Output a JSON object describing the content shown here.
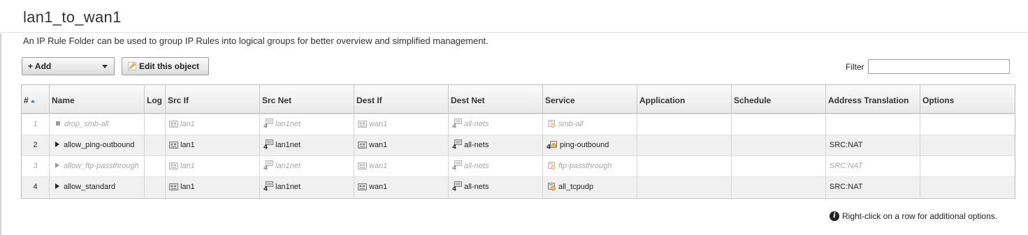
{
  "page": {
    "title": "lan1_to_wan1",
    "description": "An IP Rule Folder can be used to group IP Rules into logical groups for better overview and simplified management."
  },
  "toolbar": {
    "add_label": "+ Add",
    "edit_label": "Edit this object",
    "filter_label": "Filter",
    "filter_value": ""
  },
  "table": {
    "columns": [
      "#",
      "Name",
      "Log",
      "Src If",
      "Src Net",
      "Dest If",
      "Dest Net",
      "Service",
      "Application",
      "Schedule",
      "Address Translation",
      "Options"
    ],
    "rows": [
      {
        "num": "1",
        "name": "drop_smb-all",
        "src_if": "lan1",
        "src_net": "lan1net",
        "dest_if": "wan1",
        "dest_net": "all-nets",
        "service": "smb-all",
        "application": "",
        "schedule": "",
        "address_translation": "",
        "options": ""
      },
      {
        "num": "2",
        "name": "allow_ping-outbound",
        "src_if": "lan1",
        "src_net": "lan1net",
        "dest_if": "wan1",
        "dest_net": "all-nets",
        "service": "ping-outbound",
        "application": "",
        "schedule": "",
        "address_translation": "SRC:NAT",
        "options": ""
      },
      {
        "num": "3",
        "name": "allow_ftp-passthrough",
        "src_if": "lan1",
        "src_net": "lan1net",
        "dest_if": "wan1",
        "dest_net": "all-nets",
        "service": "ftp-passthrough",
        "application": "",
        "schedule": "",
        "address_translation": "SRC:NAT",
        "options": ""
      },
      {
        "num": "4",
        "name": "allow_standard",
        "src_if": "lan1",
        "src_net": "lan1net",
        "dest_if": "wan1",
        "dest_net": "all-nets",
        "service": "all_tcpudp",
        "application": "",
        "schedule": "",
        "address_translation": "SRC:NAT",
        "options": ""
      }
    ]
  },
  "footer": {
    "hint": "Right-click on a row for additional options."
  },
  "icons": {
    "interface": "interface-icon",
    "network": "ipv4-network-icon",
    "service": "service-icon",
    "edit": "pencil-icon",
    "info": "info-icon"
  },
  "colors": {
    "sort_arrow": "#3a7bd5",
    "disabled_text": "#a8a8a8",
    "alt_row": "#f0f0f0"
  }
}
